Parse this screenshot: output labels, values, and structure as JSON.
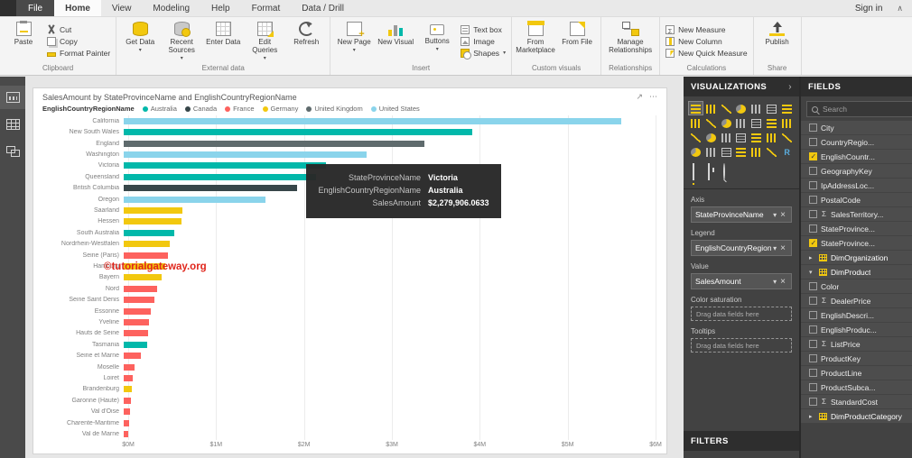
{
  "titlebar": {
    "file_tab": "File",
    "tabs": [
      "Home",
      "View",
      "Modeling",
      "Help",
      "Format",
      "Data / Drill"
    ],
    "active_tab": "Home",
    "sign_in": "Sign in"
  },
  "icons": {
    "caret": "▾",
    "close": "×",
    "chevron_right": "›",
    "collapse_ribbon": "∧",
    "focus_mode": "↗",
    "more_options": "⋯",
    "expand_collapsed": "▸",
    "expand_expanded": "▾",
    "sigma": "Σ"
  },
  "ribbon": {
    "clipboard": {
      "group": "Clipboard",
      "paste": "Paste",
      "cut": "Cut",
      "copy": "Copy",
      "format_painter": "Format Painter"
    },
    "external_data": {
      "group": "External data",
      "get_data": "Get Data",
      "recent_sources": "Recent Sources",
      "enter_data": "Enter Data",
      "edit_queries": "Edit Queries",
      "refresh": "Refresh"
    },
    "insert": {
      "group": "Insert",
      "new_page": "New Page",
      "new_visual": "New Visual",
      "buttons": "Buttons",
      "text_box": "Text box",
      "image": "Image",
      "shapes": "Shapes"
    },
    "custom_visuals": {
      "group": "Custom visuals",
      "from_marketplace": "From Marketplace",
      "from_file": "From File"
    },
    "relationships": {
      "group": "Relationships",
      "manage_relationships": "Manage Relationships"
    },
    "calculations": {
      "group": "Calculations",
      "new_measure": "New Measure",
      "new_column": "New Column",
      "new_quick_measure": "New Quick Measure"
    },
    "share": {
      "group": "Share",
      "publish": "Publish"
    }
  },
  "chart_data": {
    "type": "bar",
    "orientation": "horizontal",
    "title": "SalesAmount by StateProvinceName and EnglishCountryRegionName",
    "legend_title": "EnglishCountryRegionName",
    "legend_position": "top",
    "grid": true,
    "x_ticks": [
      "$0M",
      "$1M",
      "$2M",
      "$3M",
      "$4M",
      "$5M",
      "$6M"
    ],
    "xlim": [
      0,
      6000000
    ],
    "legend": [
      {
        "name": "Australia",
        "color": "#01B8AA"
      },
      {
        "name": "Canada",
        "color": "#374649"
      },
      {
        "name": "France",
        "color": "#FD625E"
      },
      {
        "name": "Germany",
        "color": "#F2C80F"
      },
      {
        "name": "United Kingdom",
        "color": "#5F6B6D"
      },
      {
        "name": "United States",
        "color": "#8AD4EB"
      }
    ],
    "bars": [
      {
        "state": "California",
        "country": "United States",
        "value": 5610000
      },
      {
        "state": "New South Wales",
        "country": "Australia",
        "value": 3930000
      },
      {
        "state": "England",
        "country": "United Kingdom",
        "value": 3390000
      },
      {
        "state": "Washington",
        "country": "United States",
        "value": 2740000
      },
      {
        "state": "Victoria",
        "country": "Australia",
        "value": 2279906.0633
      },
      {
        "state": "Queensland",
        "country": "Australia",
        "value": 2170000
      },
      {
        "state": "British Columbia",
        "country": "Canada",
        "value": 1960000
      },
      {
        "state": "Oregon",
        "country": "United States",
        "value": 1600000
      },
      {
        "state": "Saarland",
        "country": "Germany",
        "value": 660000
      },
      {
        "state": "Hessen",
        "country": "Germany",
        "value": 650000
      },
      {
        "state": "South Australia",
        "country": "Australia",
        "value": 570000
      },
      {
        "state": "Nordrhein-Westfalen",
        "country": "Germany",
        "value": 520000
      },
      {
        "state": "Seine (Paris)",
        "country": "France",
        "value": 500000
      },
      {
        "state": "Hamburg",
        "country": "Germany",
        "value": 470000
      },
      {
        "state": "Bayern",
        "country": "Germany",
        "value": 430000
      },
      {
        "state": "Nord",
        "country": "France",
        "value": 380000
      },
      {
        "state": "Seine Saint Denis",
        "country": "France",
        "value": 350000
      },
      {
        "state": "Essonne",
        "country": "France",
        "value": 310000
      },
      {
        "state": "Yveline",
        "country": "France",
        "value": 290000
      },
      {
        "state": "Hauts de Seine",
        "country": "France",
        "value": 280000
      },
      {
        "state": "Tasmania",
        "country": "Australia",
        "value": 260000
      },
      {
        "state": "Seine et Marne",
        "country": "France",
        "value": 190000
      },
      {
        "state": "Moselle",
        "country": "France",
        "value": 120000
      },
      {
        "state": "Loiret",
        "country": "France",
        "value": 100000
      },
      {
        "state": "Brandenburg",
        "country": "Germany",
        "value": 90000
      },
      {
        "state": "Garonne (Haute)",
        "country": "France",
        "value": 85000
      },
      {
        "state": "Val d'Oise",
        "country": "France",
        "value": 75000
      },
      {
        "state": "Charente-Maritime",
        "country": "France",
        "value": 65000
      },
      {
        "state": "Val de Marne",
        "country": "France",
        "value": 55000
      }
    ]
  },
  "tooltip": {
    "rows": [
      {
        "label": "StateProvinceName",
        "value": "Victoria"
      },
      {
        "label": "EnglishCountryRegionName",
        "value": "Australia"
      },
      {
        "label": "SalesAmount",
        "value": "$2,279,906.0633"
      }
    ]
  },
  "watermark": "©tutorialgateway.org",
  "visualizations": {
    "title": "VISUALIZATIONS",
    "icons": [
      "stacked-bar-chart",
      "stacked-column-chart",
      "clustered-bar-chart",
      "clustered-column-chart",
      "hundred-stacked-bar-chart",
      "hundred-stacked-column-chart",
      "ribbon-chart",
      "waterfall-chart",
      "scatter-chart",
      "pie-chart",
      "donut-chart",
      "treemap",
      "map",
      "filled-map",
      "line-chart",
      "area-chart",
      "stacked-area-chart",
      "line-clustered-column-chart",
      "line-stacked-column-chart",
      "funnel",
      "gauge",
      "card",
      "multi-row-card",
      "kpi",
      "slicer",
      "table",
      "matrix",
      "r-script"
    ],
    "selected_icon": "stacked-bar-chart",
    "wells": [
      {
        "label": "Axis",
        "value": "StateProvinceName"
      },
      {
        "label": "Legend",
        "value": "EnglishCountryRegionN"
      },
      {
        "label": "Value",
        "value": "SalesAmount"
      },
      {
        "label": "Color saturation",
        "placeholder": "Drag data fields here"
      },
      {
        "label": "Tooltips",
        "placeholder": "Drag data fields here"
      }
    ],
    "filters_title": "FILTERS"
  },
  "fields": {
    "title": "FIELDS",
    "search_placeholder": "Search",
    "items": [
      {
        "label": "City",
        "type": "field",
        "checked": false
      },
      {
        "label": "CountryRegio...",
        "type": "field",
        "checked": false
      },
      {
        "label": "EnglishCountr...",
        "type": "field",
        "checked": true
      },
      {
        "label": "GeographyKey",
        "type": "field",
        "checked": false
      },
      {
        "label": "IpAddressLoc...",
        "type": "field",
        "checked": false
      },
      {
        "label": "PostalCode",
        "type": "field",
        "checked": false
      },
      {
        "label": "SalesTerritory...",
        "type": "field",
        "checked": false,
        "sigma": true
      },
      {
        "label": "StateProvince...",
        "type": "field",
        "checked": false
      },
      {
        "label": "StateProvince...",
        "type": "field",
        "checked": true
      },
      {
        "label": "DimOrganization",
        "type": "table",
        "expanded": false
      },
      {
        "label": "DimProduct",
        "type": "table",
        "expanded": true
      },
      {
        "label": "Color",
        "type": "field",
        "checked": false
      },
      {
        "label": "DealerPrice",
        "type": "field",
        "checked": false,
        "sigma": true
      },
      {
        "label": "EnglishDescri...",
        "type": "field",
        "checked": false
      },
      {
        "label": "EnglishProduc...",
        "type": "field",
        "checked": false
      },
      {
        "label": "ListPrice",
        "type": "field",
        "checked": false,
        "sigma": true
      },
      {
        "label": "ProductKey",
        "type": "field",
        "checked": false
      },
      {
        "label": "ProductLine",
        "type": "field",
        "checked": false
      },
      {
        "label": "ProductSubca...",
        "type": "field",
        "checked": false
      },
      {
        "label": "StandardCost",
        "type": "field",
        "checked": false,
        "sigma": true
      },
      {
        "label": "DimProductCategory",
        "type": "table",
        "expanded": false
      }
    ]
  }
}
